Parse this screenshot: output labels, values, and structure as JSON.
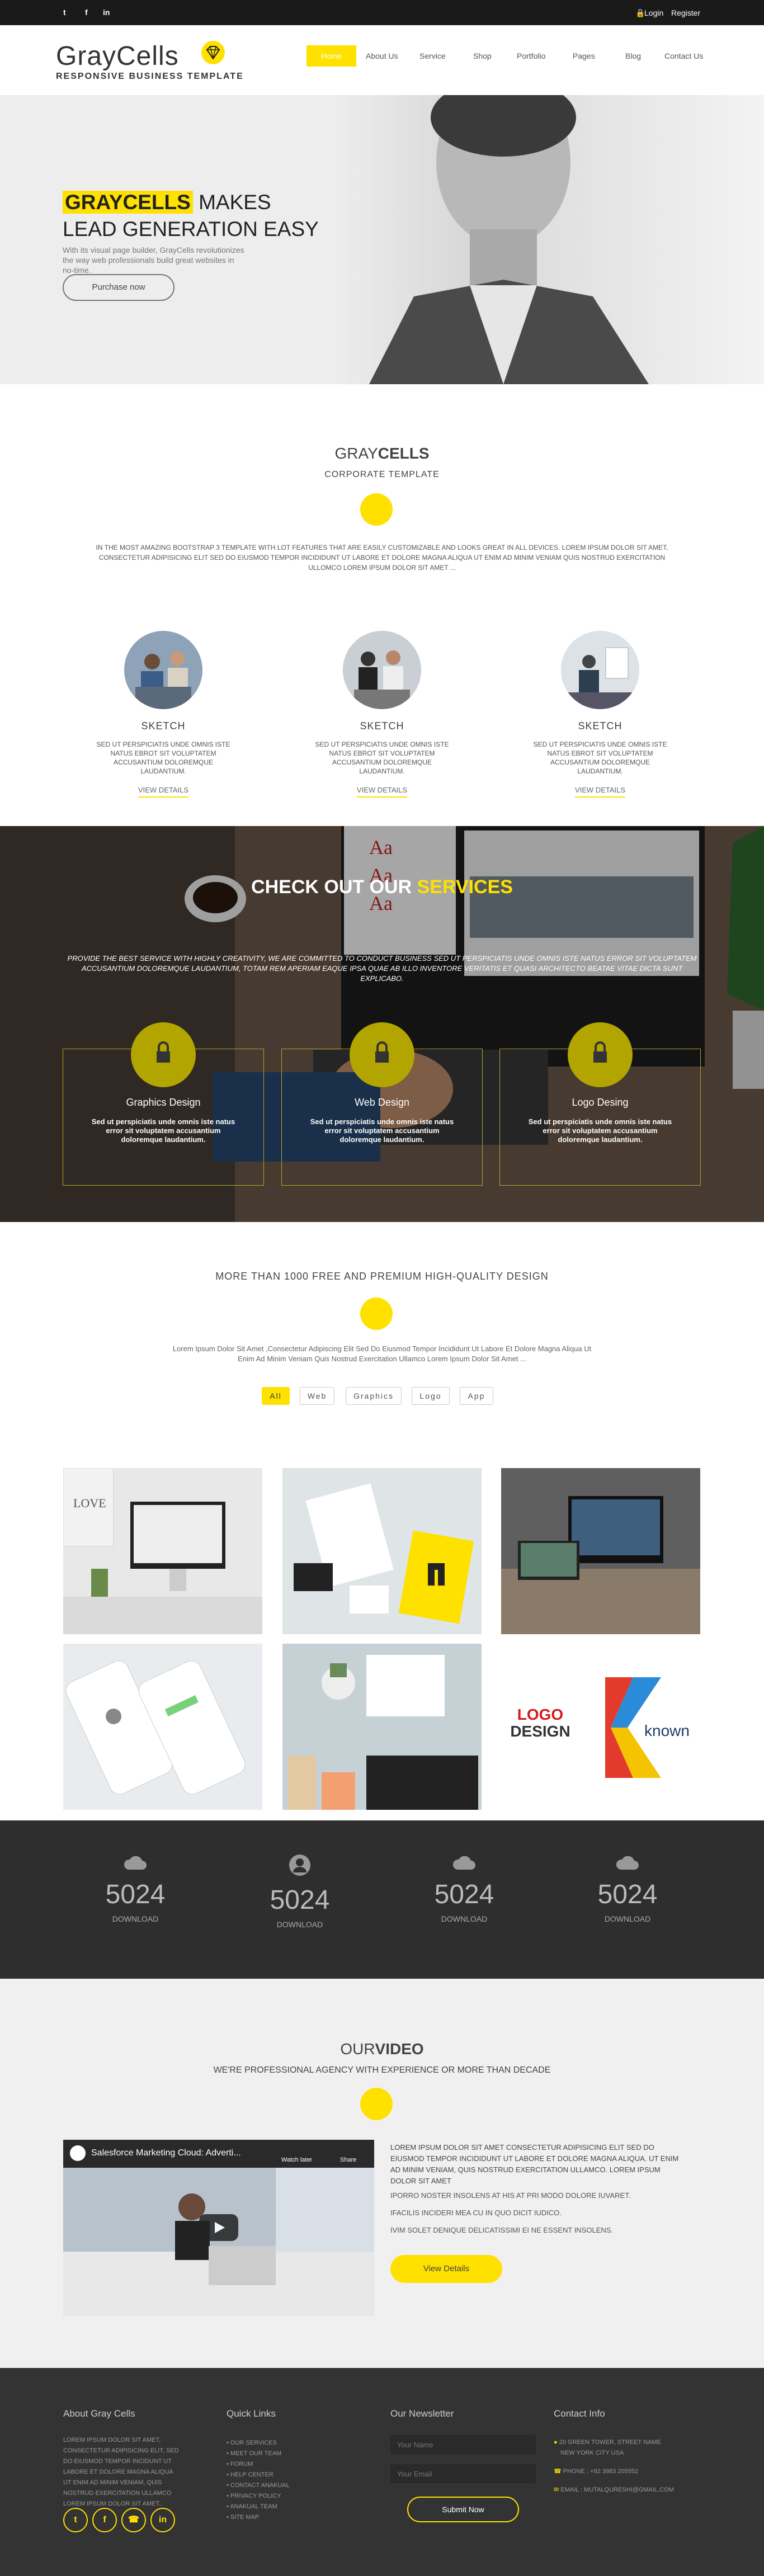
{
  "topbar": {
    "login": "Login",
    "register": "Register",
    "social": [
      "twitter-icon",
      "facebook-icon",
      "linkedin-icon"
    ]
  },
  "header": {
    "logo_text": "GrayCells",
    "logo_tagline": "RESPONSIVE BUSINESS TEMPLATE",
    "nav": [
      "Home",
      "About Us",
      "Service",
      "Shop",
      "Portfolio",
      "Pages",
      "Blog",
      "Contact Us"
    ],
    "active_nav": "Home"
  },
  "hero": {
    "title_highlight": "GRAYCELLS",
    "title_rest": "MAKES",
    "title_line2": "LEAD GENERATION EASY",
    "description": "With its visual page builder, GrayCells revolutionizes the way web professionals build great websites in no-time.",
    "button": "Purchase now"
  },
  "corporate": {
    "title_a": "GRAY",
    "title_b": "CELLS",
    "subtitle": "CORPORATE TEMPLATE",
    "text": "IN THE MOST AMAZING BOOTSTRAP 3 TEMPLATE WITH LOT FEATURES THAT ARE EASILY CUSTOMIZABLE AND LOOKS GREAT IN ALL DEVICES. LOREM IPSUM DOLOR SIT AMET, CONSECTETUR ADIPISICING ELIT SED DO EIUSMOD TEMPOR INCIDIDUNT UT LABORE ET DOLORE MAGNA ALIQUA UT ENIM AD MINIM VENIAM QUIS NOSTRUD EXERCITATION ULLOMCO LOREM IPSUM DOLOR SIT AMET ...",
    "features": [
      {
        "title": "SKETCH",
        "text": "SED UT PERSPICIATIS UNDE OMNIS ISTE NATUS EBROT SIT VOLUPTATEM ACCUSANTIUM DOLOREMQUE LAUDANTIUM.",
        "link": "VIEW DETAILS"
      },
      {
        "title": "SKETCH",
        "text": "SED UT PERSPICIATIS UNDE OMNIS ISTE NATUS EBROT SIT VOLUPTATEM ACCUSANTIUM DOLOREMQUE LAUDANTIUM.",
        "link": "VIEW DETAILS"
      },
      {
        "title": "SKETCH",
        "text": "SED UT PERSPICIATIS UNDE OMNIS ISTE NATUS EBROT SIT VOLUPTATEM ACCUSANTIUM DOLOREMQUE LAUDANTIUM.",
        "link": "VIEW DETAILS"
      }
    ]
  },
  "services": {
    "title_a": "CHECK OUT OUR",
    "title_b": "SERVICES",
    "text": "PROVIDE THE BEST SERVICE WITH HIGHLY CREATIVITY, WE ARE COMMITTED TO CONDUCT BUSINESS SED UT PERSPICIATIS UNDE OMNIS ISTE NATUS ERROR SIT VOLUPTATEM ACCUSANTIUM DOLOREMQUE LAUDANTIUM, TOTAM REM APERIAM EAQUE IPSA QUAE AB ILLO INVENTORE VERITATIS ET QUASI ARCHITECTO BEATAE VITAE DICTA SUNT EXPLICABO.",
    "items": [
      {
        "title": "Graphics Design",
        "text": "Sed ut perspiciatis unde omnis iste natus error sit voluptatem accusantium doloremque laudantium."
      },
      {
        "title": "Web Design",
        "text": "Sed ut perspiciatis unde omnis iste natus error sit voluptatem accusantium doloremque laudantium."
      },
      {
        "title": "Logo Desing",
        "text": "Sed ut perspiciatis unde omnis iste natus error sit voluptatem accusantium doloremque laudantium."
      }
    ]
  },
  "portfolio": {
    "title": "MORE THAN 1000 FREE AND PREMIUM HIGH-QUALITY DESIGN",
    "text": "Lorem Ipsum Dolor Sit Amet ,Consectetur Adipiscing Elit Sed Do Eiusmod Tempor Incididunt Ut Labore Et Dolore Magna Aliqua Ut Enim Ad Minim Veniam Quis Nostrud Exercitation Ullamco Lorem Ipsum Dolor Sit Amet ...",
    "filters": [
      "All",
      "Web",
      "Graphics",
      "Logo",
      "App"
    ],
    "active_filter": "All",
    "logo_a": "LOGO",
    "logo_b": "DESIGN",
    "known": "known"
  },
  "stats": [
    {
      "icon": "cloud-icon",
      "number": "5024",
      "label": "DOWNLOAD"
    },
    {
      "icon": "user-icon",
      "number": "5024",
      "label": "DOWNLOAD"
    },
    {
      "icon": "cloud-icon",
      "number": "5024",
      "label": "DOWNLOAD"
    },
    {
      "icon": "cloud-icon",
      "number": "5024",
      "label": "DOWNLOAD"
    }
  ],
  "video": {
    "title_a": "OUR",
    "title_b": "VIDEO",
    "subtitle": "WE'RE PROFESSIONAL AGENCY WITH EXPERIENCE OR MORE THAN DECADE",
    "player_title": "Salesforce Marketing Cloud: Adverti...",
    "watch_later": "Watch later",
    "share": "Share",
    "text": "LOREM IPSUM DOLOR SIT AMET CONSECTETUR ADIPISICING ELIT SED DO EIUSMOD TEMPOR INCIDIDUNT UT LABORE ET DOLORE MAGNA ALIQUA. UT ENIM AD MINIM VENIAM, QUIS NOSTRUD EXERCITATION ULLAMCO. LOREM IPSUM DOLOR SIT AMET",
    "list": [
      "IPORRO NOSTER INSOLENS AT HIS AT PRI MODO DOLORE IUVARET.",
      "IFACILIS INCIDERI MEA CU IN QUO DICIT IUDICO.",
      "IVIM SOLET DENIQUE DELICATISSIMI EI NE ESSENT INSOLENS."
    ],
    "button": "View Details"
  },
  "footer": {
    "about_title": "About Gray Cells",
    "about_text": "LOREM IPSUM DOLOR SIT AMET, CONSECTETUR ADIPISICING ELIT, SED DO EIUSMOD TEMPOR INCIDUNT UT LABORE ET DOLORE MAGNA ALIQUA UT ENIM AD MINIM VENIAM, QUIS NOSTRUD EXERCITATION ULLAMCO LOREM IPSUM DOLOR SIT AMET..",
    "links_title": "Quick Links",
    "links": [
      "OUR SERVICES",
      "MEET OUR TEAM",
      "FORUM",
      "HELP CENTER",
      "CONTACT ANAKUAL",
      "PRIVACY POLICY",
      "ANAKUAL TEAM",
      "SITE MAP"
    ],
    "newsletter_title": "Our Newsletter",
    "name_placeholder": "Your Name",
    "email_placeholder": "Your Email",
    "submit": "Submit Now",
    "contact_title": "Contact Info",
    "address_1": "20 GREEN TOWER, STREET NAME",
    "address_2": "NEW YORK CITY USA",
    "phone": "PHONE : +92 3983 205552",
    "email": "EMAIL : MUTALQURESHI@GMAIL.COM",
    "social": [
      "twitter-icon",
      "facebook-icon",
      "phone-icon",
      "linkedin-icon"
    ]
  },
  "colors": {
    "accent": "#ffe100",
    "dark": "#333333",
    "topbar": "#1a1a1a"
  }
}
